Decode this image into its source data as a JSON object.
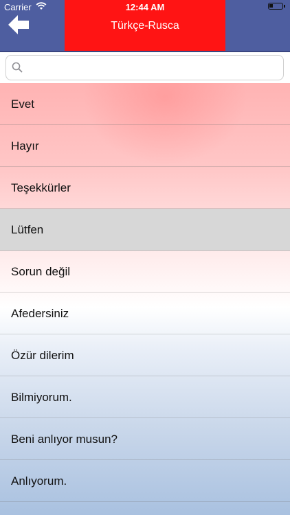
{
  "status_bar": {
    "carrier": "Carrier",
    "time": "12:44 AM"
  },
  "nav": {
    "title": "Türkçe-Rusca",
    "back_icon": "arrow-left-icon",
    "colors": {
      "side": "#4e5ea0",
      "center": "#ff1414"
    }
  },
  "search": {
    "value": "",
    "placeholder": "",
    "icon": "search-icon"
  },
  "list": {
    "items": [
      {
        "label": "Evet"
      },
      {
        "label": "Hayır"
      },
      {
        "label": "Teşekkürler"
      },
      {
        "label": "Lütfen",
        "selected": true
      },
      {
        "label": "Sorun değil"
      },
      {
        "label": "Afedersiniz"
      },
      {
        "label": "Özür dilerim"
      },
      {
        "label": "Bilmiyorum."
      },
      {
        "label": "Beni anlıyor musun?"
      },
      {
        "label": "Anlıyorum."
      }
    ]
  }
}
